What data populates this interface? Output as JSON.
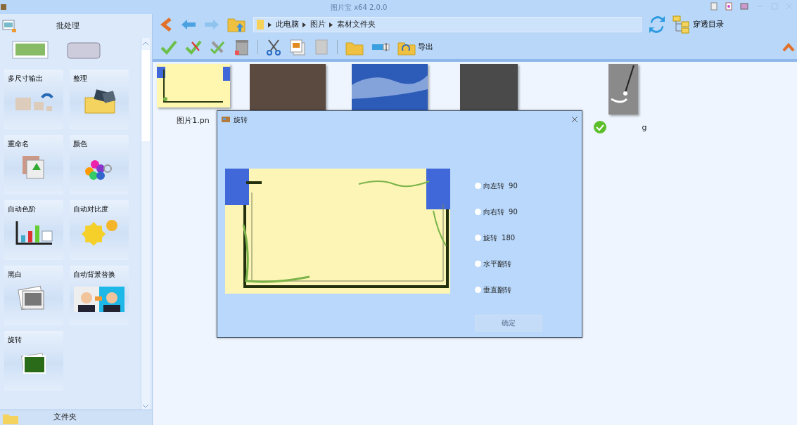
{
  "window": {
    "title": "图片宝 x64 2.0.0"
  },
  "sidebar": {
    "header": "批处理",
    "tools": [
      {
        "label": "多尺寸输出"
      },
      {
        "label": "整理"
      },
      {
        "label": "重命名"
      },
      {
        "label": "颜色"
      },
      {
        "label": "自动色阶"
      },
      {
        "label": "自动对比度"
      },
      {
        "label": "黑白"
      },
      {
        "label": "自动背景替换"
      },
      {
        "label": "旋转"
      }
    ],
    "footer": "文件夹"
  },
  "nav": {
    "breadcrumb": [
      "此电脑",
      "图片",
      "素材文件夹"
    ],
    "through_dir": "穿透目录"
  },
  "toolbar": {
    "export": "导出"
  },
  "files": [
    {
      "kind": "frame",
      "name": "图片1.pn"
    },
    {
      "kind": "photo"
    },
    {
      "kind": "sky"
    },
    {
      "kind": "cartoon"
    },
    {
      "kind": "spoon",
      "name": "g"
    }
  ],
  "dialog": {
    "title": "旋转",
    "options": [
      {
        "label": "向左转  90",
        "selected": false
      },
      {
        "label": "向右转  90",
        "selected": false
      },
      {
        "label": "旋转  180",
        "selected": false
      },
      {
        "label": "水平翻转",
        "selected": false
      },
      {
        "label": "垂直翻转",
        "selected": false
      }
    ],
    "ok": {
      "label": "确定",
      "disabled": true
    }
  }
}
